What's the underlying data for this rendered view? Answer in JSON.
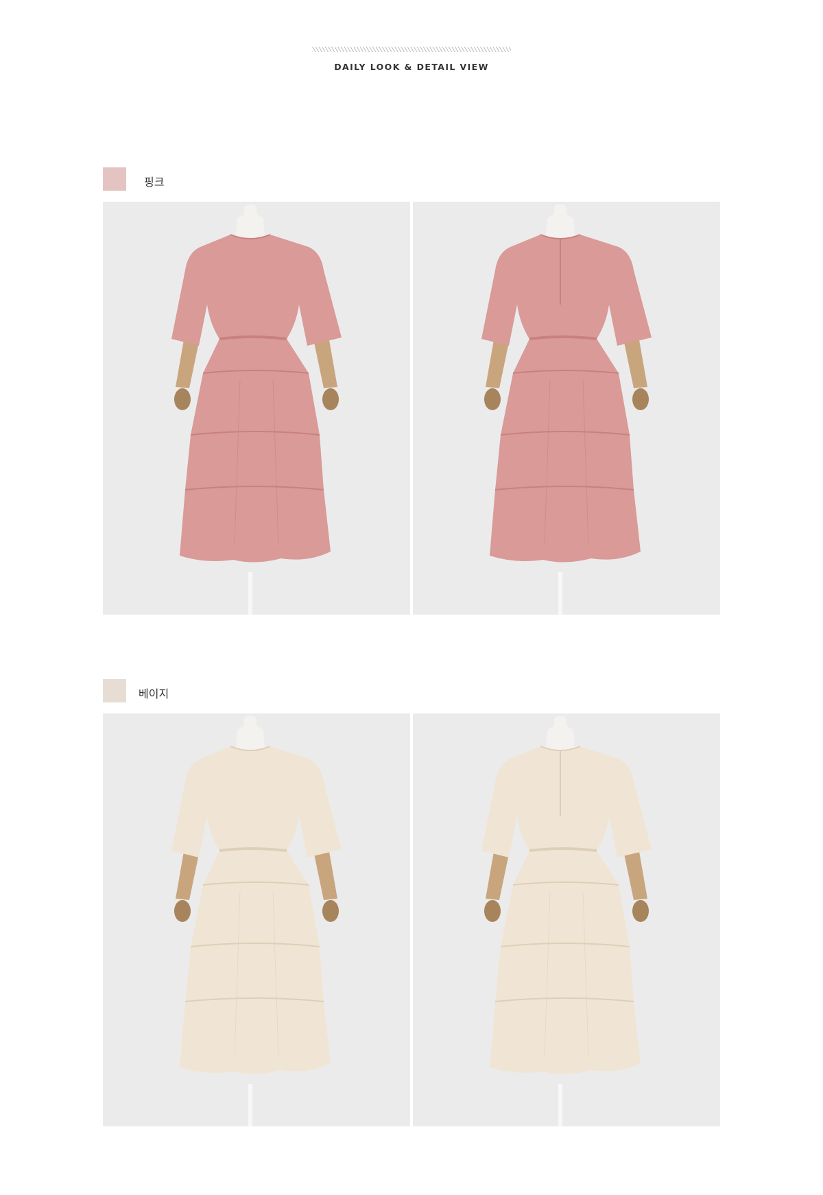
{
  "header": {
    "title": "DAILY LOOK & DETAIL VIEW"
  },
  "colors": [
    {
      "label": "핑크",
      "swatch": "#e3c4c3",
      "dress": "#d99a98",
      "dress_shade": "#c8817f",
      "photos": [
        {
          "view": "front",
          "icon": "dress-front-icon"
        },
        {
          "view": "back",
          "icon": "dress-back-icon"
        }
      ]
    },
    {
      "label": "베이지",
      "swatch": "#e7ddd4",
      "dress": "#f0e5d4",
      "dress_shade": "#ddcfb8",
      "photos": [
        {
          "view": "front",
          "icon": "dress-front-icon"
        },
        {
          "view": "back",
          "icon": "dress-back-icon"
        }
      ]
    }
  ]
}
